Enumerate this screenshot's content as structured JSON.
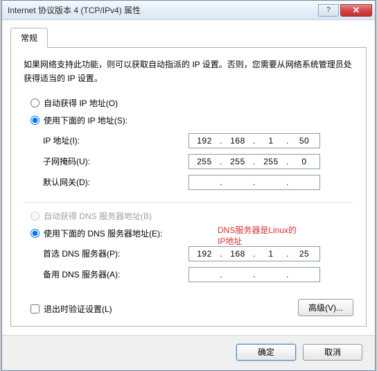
{
  "window": {
    "title": "Internet 协议版本 4 (TCP/IPv4) 属性"
  },
  "tab": {
    "label": "常规"
  },
  "description": "如果网络支持此功能，则可以获取自动指派的 IP 设置。否则，您需要从网络系统管理员处获得适当的 IP 设置。",
  "ip_section": {
    "auto_label": "自动获得 IP 地址(O)",
    "manual_label": "使用下面的 IP 地址(S):",
    "ip_label": "IP 地址(I):",
    "ip_value": [
      "192",
      "168",
      "1",
      "50"
    ],
    "mask_label": "子网掩码(U):",
    "mask_value": [
      "255",
      "255",
      "255",
      "0"
    ],
    "gateway_label": "默认网关(D):",
    "gateway_value": [
      "",
      "",
      "",
      ""
    ]
  },
  "dns_section": {
    "auto_label": "自动获得 DNS 服务器地址(B)",
    "manual_label": "使用下面的 DNS 服务器地址(E):",
    "primary_label": "首选 DNS 服务器(P):",
    "primary_value": [
      "192",
      "168",
      "1",
      "25"
    ],
    "alt_label": "备用 DNS 服务器(A):",
    "alt_value": [
      "",
      "",
      "",
      ""
    ]
  },
  "annotation": {
    "line1": "DNS服务器是Linux的",
    "line2": "IP地址"
  },
  "validate_checkbox": "退出时验证设置(L)",
  "advanced_button": "高级(V)...",
  "buttons": {
    "ok": "确定",
    "cancel": "取消"
  }
}
